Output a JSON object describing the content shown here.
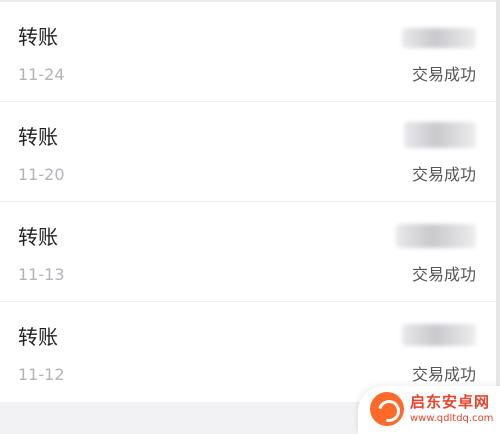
{
  "transactions": [
    {
      "title": "转账",
      "date": "11-24",
      "status": "交易成功"
    },
    {
      "title": "转账",
      "date": "11-20",
      "status": "交易成功"
    },
    {
      "title": "转账",
      "date": "11-13",
      "status": "交易成功"
    },
    {
      "title": "转账",
      "date": "11-12",
      "status": "交易成功"
    }
  ],
  "watermark": {
    "name": "启东安卓网",
    "url": "www.qdltdq.com"
  },
  "colors": {
    "title": "#222222",
    "date": "#b3b3b8",
    "status": "#555555",
    "divider": "#ececef",
    "background": "#f2f2f4",
    "watermark": "#e8452c"
  }
}
